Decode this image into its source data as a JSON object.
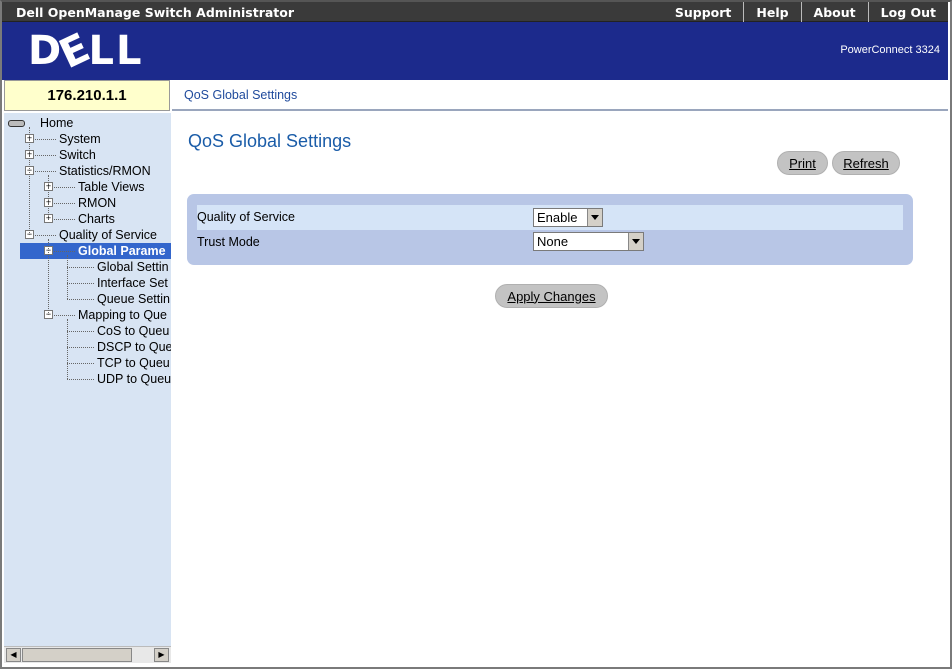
{
  "app": {
    "title": "Dell OpenManage Switch Administrator",
    "menu": [
      "Support",
      "Help",
      "About",
      "Log Out"
    ]
  },
  "banner": {
    "logo_text": "DELL",
    "product": "PowerConnect 3324"
  },
  "device": {
    "ip": "176.210.1.1"
  },
  "breadcrumb": "QoS Global Settings",
  "tree": {
    "items": [
      {
        "label": "Home",
        "depth": 0,
        "expander": "none",
        "selected": false
      },
      {
        "label": "System",
        "depth": 1,
        "expander": "+",
        "selected": false
      },
      {
        "label": "Switch",
        "depth": 1,
        "expander": "+",
        "selected": false
      },
      {
        "label": "Statistics/RMON",
        "depth": 1,
        "expander": "-",
        "selected": false
      },
      {
        "label": "Table Views",
        "depth": 2,
        "expander": "+",
        "selected": false
      },
      {
        "label": "RMON",
        "depth": 2,
        "expander": "+",
        "selected": false
      },
      {
        "label": "Charts",
        "depth": 2,
        "expander": "+",
        "selected": false
      },
      {
        "label": "Quality of Service",
        "depth": 1,
        "expander": "-",
        "selected": false
      },
      {
        "label": "Global Parame",
        "depth": 2,
        "expander": "-",
        "selected": true
      },
      {
        "label": "Global Settin",
        "depth": 3,
        "expander": "none",
        "selected": false
      },
      {
        "label": "Interface Set",
        "depth": 3,
        "expander": "none",
        "selected": false
      },
      {
        "label": "Queue Settin",
        "depth": 3,
        "expander": "none",
        "selected": false
      },
      {
        "label": "Mapping to Que",
        "depth": 2,
        "expander": "-",
        "selected": false
      },
      {
        "label": "CoS to Queu",
        "depth": 3,
        "expander": "none",
        "selected": false
      },
      {
        "label": "DSCP to Que",
        "depth": 3,
        "expander": "none",
        "selected": false
      },
      {
        "label": "TCP to Queu",
        "depth": 3,
        "expander": "none",
        "selected": false
      },
      {
        "label": "UDP to Queu",
        "depth": 3,
        "expander": "none",
        "selected": false
      }
    ]
  },
  "main": {
    "title": "QoS Global Settings",
    "print_label": "Print",
    "refresh_label": "Refresh",
    "fields": {
      "qos_label": "Quality of Service",
      "qos_value": "Enable",
      "trust_label": "Trust Mode",
      "trust_value": "None"
    },
    "apply_label": "Apply Changes"
  },
  "colors": {
    "banner": "#1c2a8c",
    "tree_bg": "#d8e4f3",
    "tree_selected": "#3366cc",
    "title": "#1a5ca8",
    "panel": "#b8c6e6"
  }
}
